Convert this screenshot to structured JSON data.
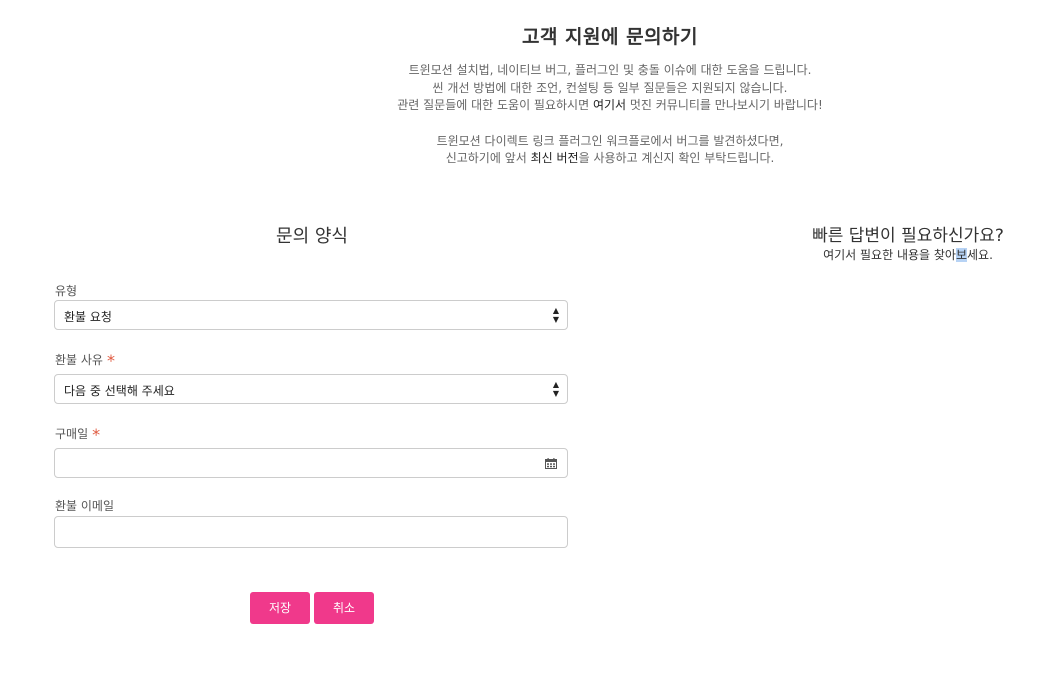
{
  "header": {
    "title": "고객 지원에 문의하기",
    "intro_line1": "트윈모션 설치법, 네이티브 버그, 플러그인 및 충돌 이슈에 대한 도움을 드립니다.",
    "intro_line2": "씬 개선 방법에 대한 조언, 컨설팅 등 일부 질문들은 지원되지 않습니다.",
    "intro_line3_before": "관련 질문들에 대한 도움이 필요하시면 ",
    "intro_line3_link": "여기서",
    "intro_line3_after": " 멋진 커뮤니티를 만나보시기 바랍니다!",
    "intro_line4": "트윈모션 다이렉트 링크 플러그인 워크플로에서 버그를 발견하셨다면,",
    "intro_line5_before": "신고하기에 앞서 ",
    "intro_line5_link": "최신 버전",
    "intro_line5_after": "을 사용하고 계신지 확인 부탁드립니다."
  },
  "form": {
    "heading": "문의 양식",
    "type_label": "유형",
    "type_value": "환불 요청",
    "reason_label": "환불 사유",
    "reason_value": "다음 중 선택해 주세요",
    "purchase_date_label": "구매일",
    "purchase_date_value": "",
    "refund_email_label": "환불 이메일",
    "refund_email_value": "",
    "required_mark": "*",
    "save_label": "저장",
    "cancel_label": "취소"
  },
  "quick_help": {
    "title": "빠른 답변이 필요하신가요?",
    "sub_before": "여기서 필요한 내용을 찾아",
    "sub_highlight": "보",
    "sub_after": "세요."
  },
  "colors": {
    "accent": "#f0398b",
    "required": "#e0593f",
    "selection_highlight": "#b7d3f5"
  }
}
